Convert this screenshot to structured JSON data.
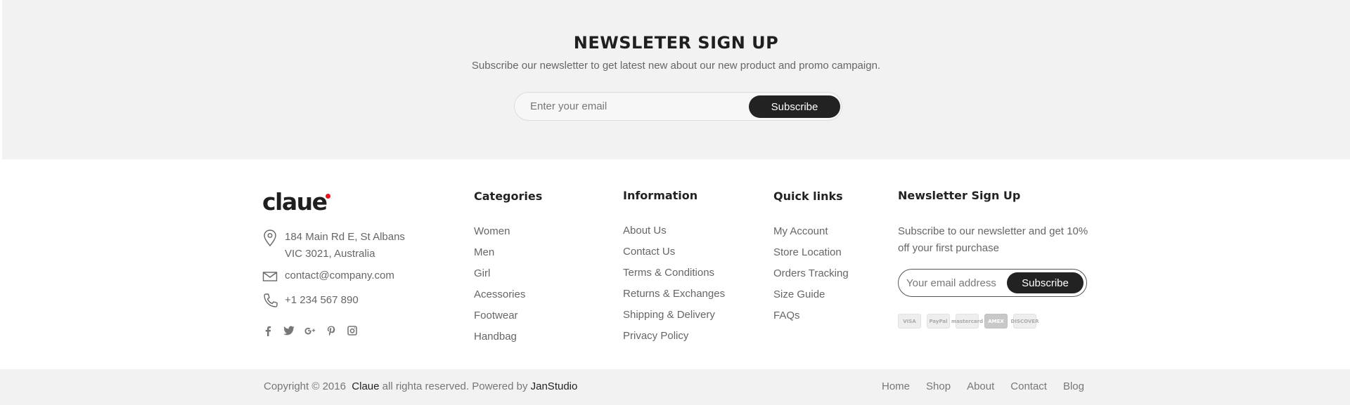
{
  "newsletter": {
    "title": "NEWSLETER SIGN UP",
    "subtitle": "Subscribe our newsletter to get latest new about our new product and promo campaign.",
    "email_placeholder": "Enter your email",
    "button_label": "Subscribe"
  },
  "brand": {
    "logo_text": "claue",
    "accent_color": "#e8151b"
  },
  "contact": {
    "address_line1": "184 Main Rd E, St Albans",
    "address_line2": "VIC 3021, Australia",
    "email": "contact@company.com",
    "phone": "+1 234 567 890",
    "icons": [
      "map-pin-icon",
      "envelope-icon",
      "phone-icon"
    ]
  },
  "socials": [
    {
      "name": "facebook-icon",
      "glyph": "f"
    },
    {
      "name": "twitter-icon",
      "glyph": "t"
    },
    {
      "name": "google-plus-icon",
      "glyph": "g+"
    },
    {
      "name": "pinterest-icon",
      "glyph": "p"
    },
    {
      "name": "instagram-icon",
      "glyph": "ig"
    }
  ],
  "categories": {
    "title": "Categories",
    "items": [
      "Women",
      "Men",
      "Girl",
      "Acessories",
      "Footwear",
      "Handbag"
    ]
  },
  "information": {
    "title": "Information",
    "items": [
      "About Us",
      "Contact Us",
      "Terms & Conditions",
      "Returns & Exchanges",
      "Shipping & Delivery",
      "Privacy Policy"
    ]
  },
  "quick_links": {
    "title": "Quick links",
    "items": [
      "My Account",
      "Store Location",
      "Orders Tracking",
      "Size Guide",
      "FAQs"
    ]
  },
  "footer_newsletter": {
    "title": "Newsletter Sign Up",
    "text": "Subscribe to our newsletter and get 10% off your first purchase",
    "email_placeholder": "Your email address",
    "button_label": "Subscribe"
  },
  "payments": [
    "VISA",
    "PayPal",
    "mastercard",
    "AMEX",
    "DISCOVER"
  ],
  "bottom": {
    "copyright_prefix": "Copyright © 2016",
    "brand": "Claue",
    "copyright_middle": "all righta reserved. Powered by",
    "powered_by": "JanStudio",
    "nav": [
      "Home",
      "Shop",
      "About",
      "Contact",
      "Blog"
    ]
  }
}
